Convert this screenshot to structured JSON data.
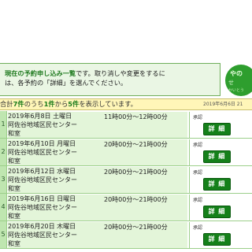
{
  "intro": {
    "highlight": "現在の予約申し込み一覧",
    "text1": "です。取り消しや変更をするに",
    "text2": "は、各予約の「詳細」を選んでください。"
  },
  "logo": {
    "line1": "やの",
    "line2": "せ",
    "line3": "かいとう"
  },
  "summary": {
    "prefix": "合計",
    "total": "7件",
    "mid": "のうち",
    "from": "1件",
    "to_word": "から",
    "to": "5件",
    "suffix": "を表示しています。",
    "date": "2019年6月6日 21"
  },
  "reservations": [
    {
      "num": "1",
      "date": "2019年6月8日 土曜日",
      "time": "11時00分～12時00分",
      "facility": "阿佐谷地域区民センター",
      "room": "和室",
      "status": "承認",
      "detail": "詳 細"
    },
    {
      "num": "2",
      "date": "2019年6月10日 月曜日",
      "time": "20時00分～21時00分",
      "facility": "阿佐谷地域区民センター",
      "room": "和室",
      "status": "承認",
      "detail": "詳 細"
    },
    {
      "num": "3",
      "date": "2019年6月12日 水曜日",
      "time": "20時00分～21時00分",
      "facility": "阿佐谷地域区民センター",
      "room": "和室",
      "status": "承認",
      "detail": "詳 細"
    },
    {
      "num": "4",
      "date": "2019年6月16日 日曜日",
      "time": "20時00分～21時00分",
      "facility": "阿佐谷地域区民センター",
      "room": "和室",
      "status": "承認",
      "detail": "詳 細"
    },
    {
      "num": "5",
      "date": "2019年6月20日 木曜日",
      "time": "20時00分～21時00分",
      "facility": "阿佐谷地域区民センター",
      "room": "和室",
      "status": "承認",
      "detail": "詳 細"
    }
  ]
}
